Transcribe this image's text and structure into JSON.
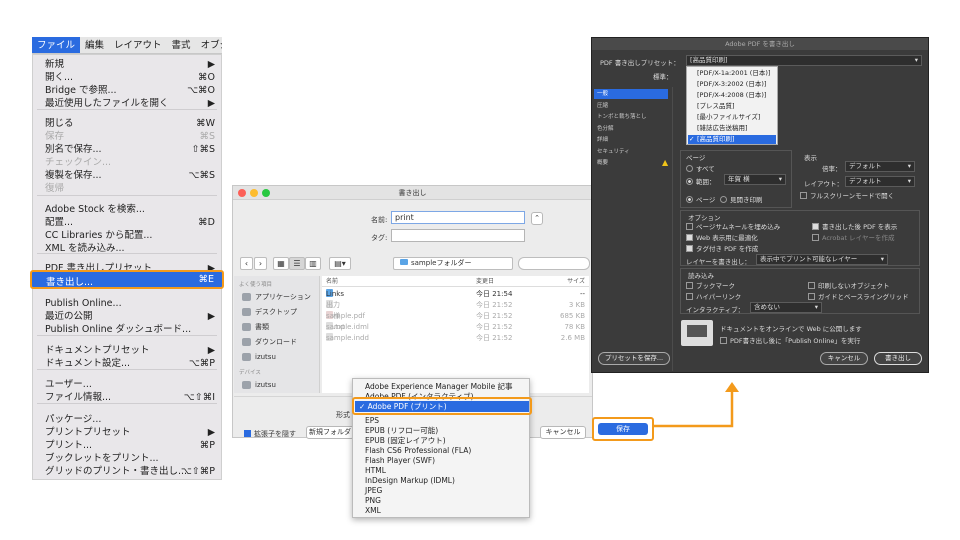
{
  "menubar": {
    "items": [
      "ファイル",
      "編集",
      "レイアウト",
      "書式",
      "オブジ"
    ]
  },
  "file_menu": {
    "items": [
      {
        "label": "新規",
        "shortcut": "▶",
        "disabled": false
      },
      {
        "label": "開く...",
        "shortcut": "⌘O",
        "disabled": false
      },
      {
        "label": "Bridge で参照...",
        "shortcut": "⌥⌘O",
        "disabled": false
      },
      {
        "label": "最近使用したファイルを開く",
        "shortcut": "▶",
        "disabled": false
      },
      {
        "label": "閉じる",
        "shortcut": "⌘W",
        "disabled": false
      },
      {
        "label": "保存",
        "shortcut": "⌘S",
        "disabled": true
      },
      {
        "label": "別名で保存...",
        "shortcut": "⇧⌘S",
        "disabled": false
      },
      {
        "label": "チェックイン...",
        "shortcut": "",
        "disabled": true
      },
      {
        "label": "複製を保存...",
        "shortcut": "⌥⌘S",
        "disabled": false
      },
      {
        "label": "復帰",
        "shortcut": "",
        "disabled": true
      },
      {
        "label": "Adobe Stock を検索...",
        "shortcut": "",
        "disabled": false
      },
      {
        "label": "配置...",
        "shortcut": "⌘D",
        "disabled": false
      },
      {
        "label": "CC Libraries から配置...",
        "shortcut": "",
        "disabled": false
      },
      {
        "label": "XML を読み込み...",
        "shortcut": "",
        "disabled": false
      },
      {
        "label": "PDF 書き出しプリセット",
        "shortcut": "▶",
        "disabled": false
      },
      {
        "label": "Publish Online...",
        "shortcut": "",
        "disabled": false
      },
      {
        "label": "最近の公開",
        "shortcut": "▶",
        "disabled": false
      },
      {
        "label": "Publish Online ダッシュボード...",
        "shortcut": "",
        "disabled": false
      },
      {
        "label": "ドキュメントプリセット",
        "shortcut": "▶",
        "disabled": false
      },
      {
        "label": "ドキュメント設定...",
        "shortcut": "⌥⌘P",
        "disabled": false
      },
      {
        "label": "ユーザー...",
        "shortcut": "",
        "disabled": false
      },
      {
        "label": "ファイル情報...",
        "shortcut": "⌥⇧⌘I",
        "disabled": false
      },
      {
        "label": "パッケージ...",
        "shortcut": "",
        "disabled": false
      },
      {
        "label": "プリントプリセット",
        "shortcut": "▶",
        "disabled": false
      },
      {
        "label": "プリント...",
        "shortcut": "⌘P",
        "disabled": false
      },
      {
        "label": "ブックレットをプリント...",
        "shortcut": "",
        "disabled": false
      },
      {
        "label": "グリッドのプリント・書き出し...",
        "shortcut": "⌥⇧⌘P",
        "disabled": false
      }
    ],
    "highlighted": {
      "label": "書き出し...",
      "shortcut": "⌘E"
    }
  },
  "save_dialog": {
    "title": "書き出し",
    "name_label": "名前:",
    "name_value": "print",
    "tag_label": "タグ:",
    "folder": "sampleフォルダー",
    "sidebar": {
      "favorites_header": "よく使う項目",
      "favorites": [
        "アプリケーション",
        "デスクトップ",
        "書類",
        "ダウンロード",
        "izutsu"
      ],
      "devices_header": "デバイス",
      "devices": [
        "izutsu"
      ]
    },
    "columns": {
      "name": "名前",
      "date": "変更日",
      "size": "サイズ"
    },
    "files": [
      {
        "name": "Links",
        "date": "今日 21:54",
        "size": "--",
        "grey": false
      },
      {
        "name": "出力仕様書.txt",
        "date": "今日 21:52",
        "size": "3 KB",
        "grey": true
      },
      {
        "name": "sample.pdf",
        "date": "今日 21:52",
        "size": "685 KB",
        "grey": true
      },
      {
        "name": "sample.idml",
        "date": "今日 21:52",
        "size": "78 KB",
        "grey": true
      },
      {
        "name": "sample.indd",
        "date": "今日 21:52",
        "size": "2.6 MB",
        "grey": true
      }
    ],
    "format_label": "形式",
    "ext_checkbox": "拡張子を隠す",
    "new_folder": "新規フォルダ",
    "cancel": "キャンセル",
    "save": "保存"
  },
  "format_menu": {
    "items": [
      "Adobe Experience Manager Mobile 記事",
      "Adobe PDF (インタラクティブ)"
    ],
    "selected": "Adobe PDF (プリント)",
    "items_after": [
      "EPS",
      "EPUB (リフロー可能)",
      "EPUB (固定レイアウト)",
      "Flash CS6 Professional (FLA)",
      "Flash Player (SWF)",
      "HTML",
      "InDesign Markup (IDML)",
      "JPEG",
      "PNG",
      "XML"
    ]
  },
  "pdf_dialog": {
    "title": "Adobe PDF を書き出し",
    "preset_label": "PDF 書き出しプリセット：",
    "preset_value": "[高品質印刷]",
    "standard_label": "標準：",
    "standard_options": [
      "[PDF/X-1a:2001 (日本)]",
      "[PDF/X-3:2002 (日本)]",
      "[PDF/X-4:2008 (日本)]",
      "[プレス品質]",
      "[最小ファイルサイズ]",
      "[雑誌広告送稿用]",
      "[高品質印刷]"
    ],
    "sidebar": [
      "一般",
      "圧縮",
      "トンボと裁ち落とし",
      "色分解",
      "詳細",
      "セキュリティ",
      "概要"
    ],
    "pages_header": "ページ",
    "all": "すべて",
    "range": "範囲：",
    "range_value": "年賀 横",
    "pages_opt": "ページ",
    "spreads_opt": "見開き印刷",
    "view_header": "表示",
    "zoom_label": "倍率：",
    "zoom_value": "デフォルト",
    "layout_label": "レイアウト：",
    "layout_value": "デフォルト",
    "fullscreen": "フルスクリーンモードで開く",
    "options_header": "オプション",
    "opt_thumbs": "ページサムネールを埋め込み",
    "opt_view_after": "書き出した後 PDF を表示",
    "opt_web": "Web 表示用に最適化",
    "opt_acrobat_layers": "Acrobat レイヤーを作成",
    "opt_tagged": "タグ付き PDF を作成",
    "layers_label": "レイヤーを書き出し：",
    "layers_value": "表示中でプリント可能なレイヤー",
    "include_header": "読み込み",
    "inc_bookmarks": "ブックマーク",
    "inc_nonprint": "印刷しないオブジェクト",
    "inc_hyperlinks": "ハイパーリンク",
    "inc_guides": "ガイドとベースライングリッド",
    "interactive_label": "インタラクティブ：",
    "interactive_value": "含めない",
    "publish_text": "ドキュメントをオンラインで Web に公開します",
    "publish_checkbox": "PDF書き出し後に「Publish Online」を実行",
    "save_preset": "プリセットを保存...",
    "cancel": "キャンセル",
    "export": "書き出し"
  },
  "colors": {
    "accent": "#2a6be0",
    "highlight": "#f39a1b"
  }
}
